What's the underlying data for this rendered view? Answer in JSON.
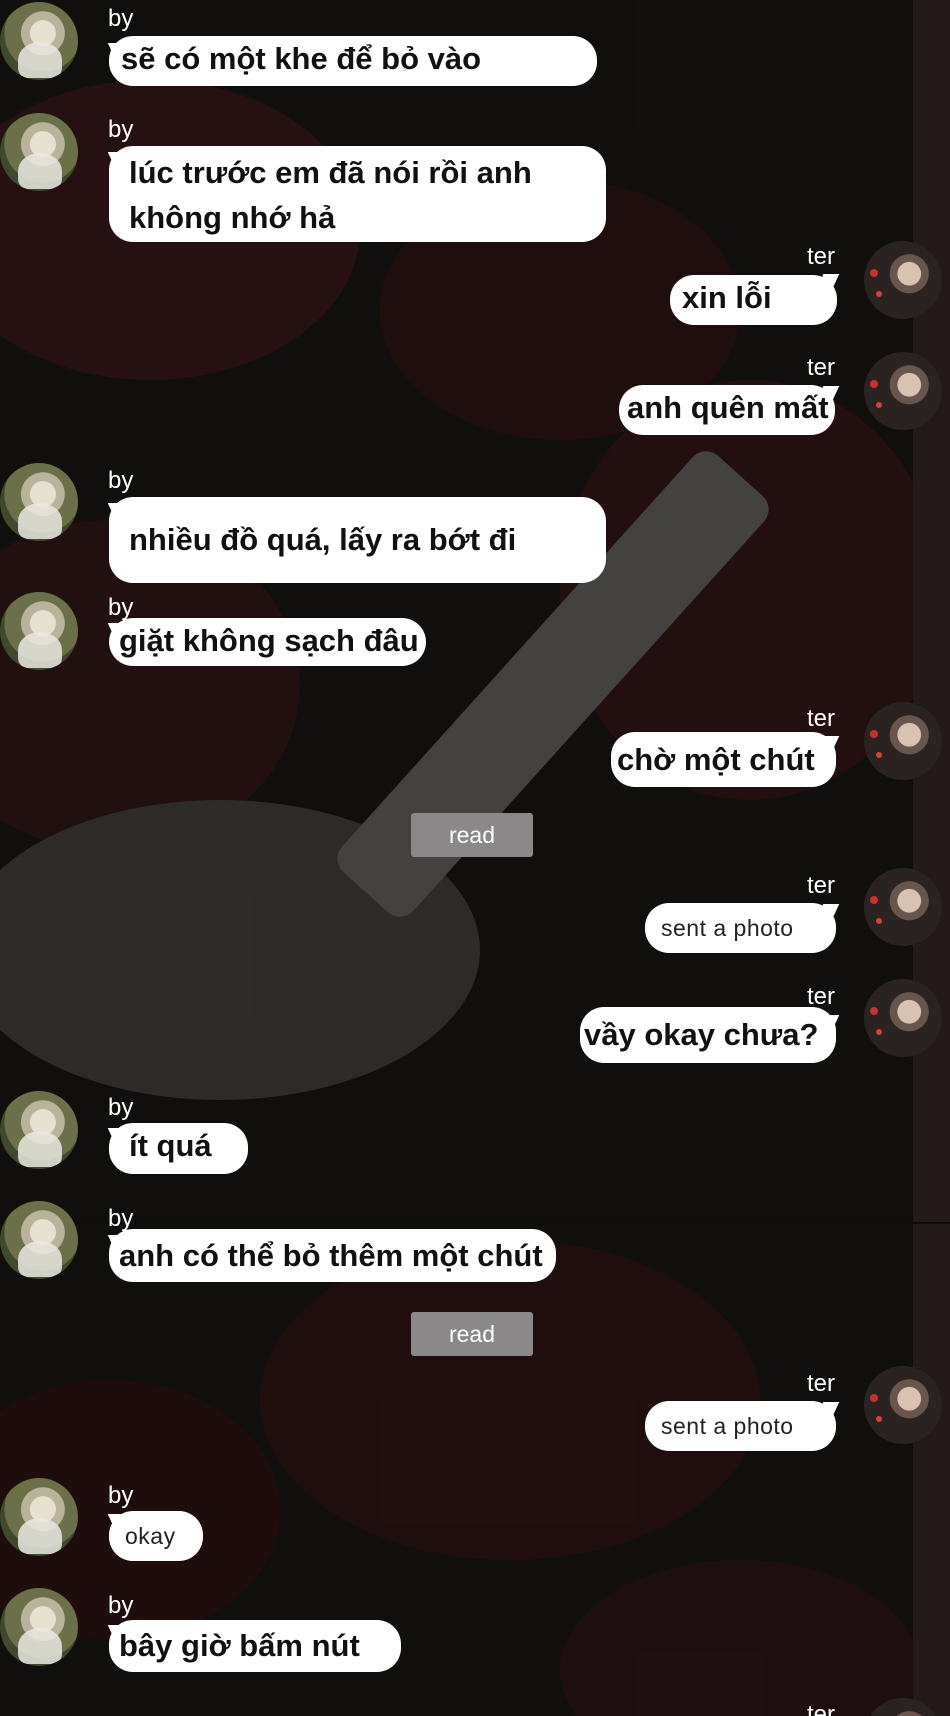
{
  "contacts": {
    "left_name": "by",
    "right_name": "ter"
  },
  "messages": [
    {
      "side": "left",
      "name": "by",
      "text": "sẽ có một khe để bỏ vào"
    },
    {
      "side": "left",
      "name": "by",
      "text": "lúc trước em đã nói rồi anh không nhớ hả"
    },
    {
      "side": "right",
      "name": "ter",
      "text": "xin lỗi"
    },
    {
      "side": "right",
      "name": "ter",
      "text": "anh quên mất"
    },
    {
      "side": "left",
      "name": "by",
      "text": "nhiều đồ quá, lấy ra bớt đi"
    },
    {
      "side": "left",
      "name": "by",
      "text": "giặt không sạch đâu"
    },
    {
      "side": "right",
      "name": "ter",
      "text": "chờ một chút"
    },
    {
      "side": "system",
      "text": "read"
    },
    {
      "side": "right",
      "name": "ter",
      "text": "sent a photo"
    },
    {
      "side": "right",
      "name": "ter",
      "text": "vầy okay chưa?"
    },
    {
      "side": "left",
      "name": "by",
      "text": "ít quá"
    },
    {
      "side": "left",
      "name": "by",
      "text": "anh có thể bỏ thêm một chút"
    },
    {
      "side": "system",
      "text": "read"
    },
    {
      "side": "right",
      "name": "ter",
      "text": "sent a photo"
    },
    {
      "side": "left",
      "name": "by",
      "text": "okay"
    },
    {
      "side": "left",
      "name": "by",
      "text": "bây giờ bấm nút"
    },
    {
      "side": "right",
      "name": "ter",
      "text": ""
    }
  ],
  "colors": {
    "bubble": "#ffffff",
    "read_badge": "#8a8888",
    "background": "#1c1718"
  }
}
